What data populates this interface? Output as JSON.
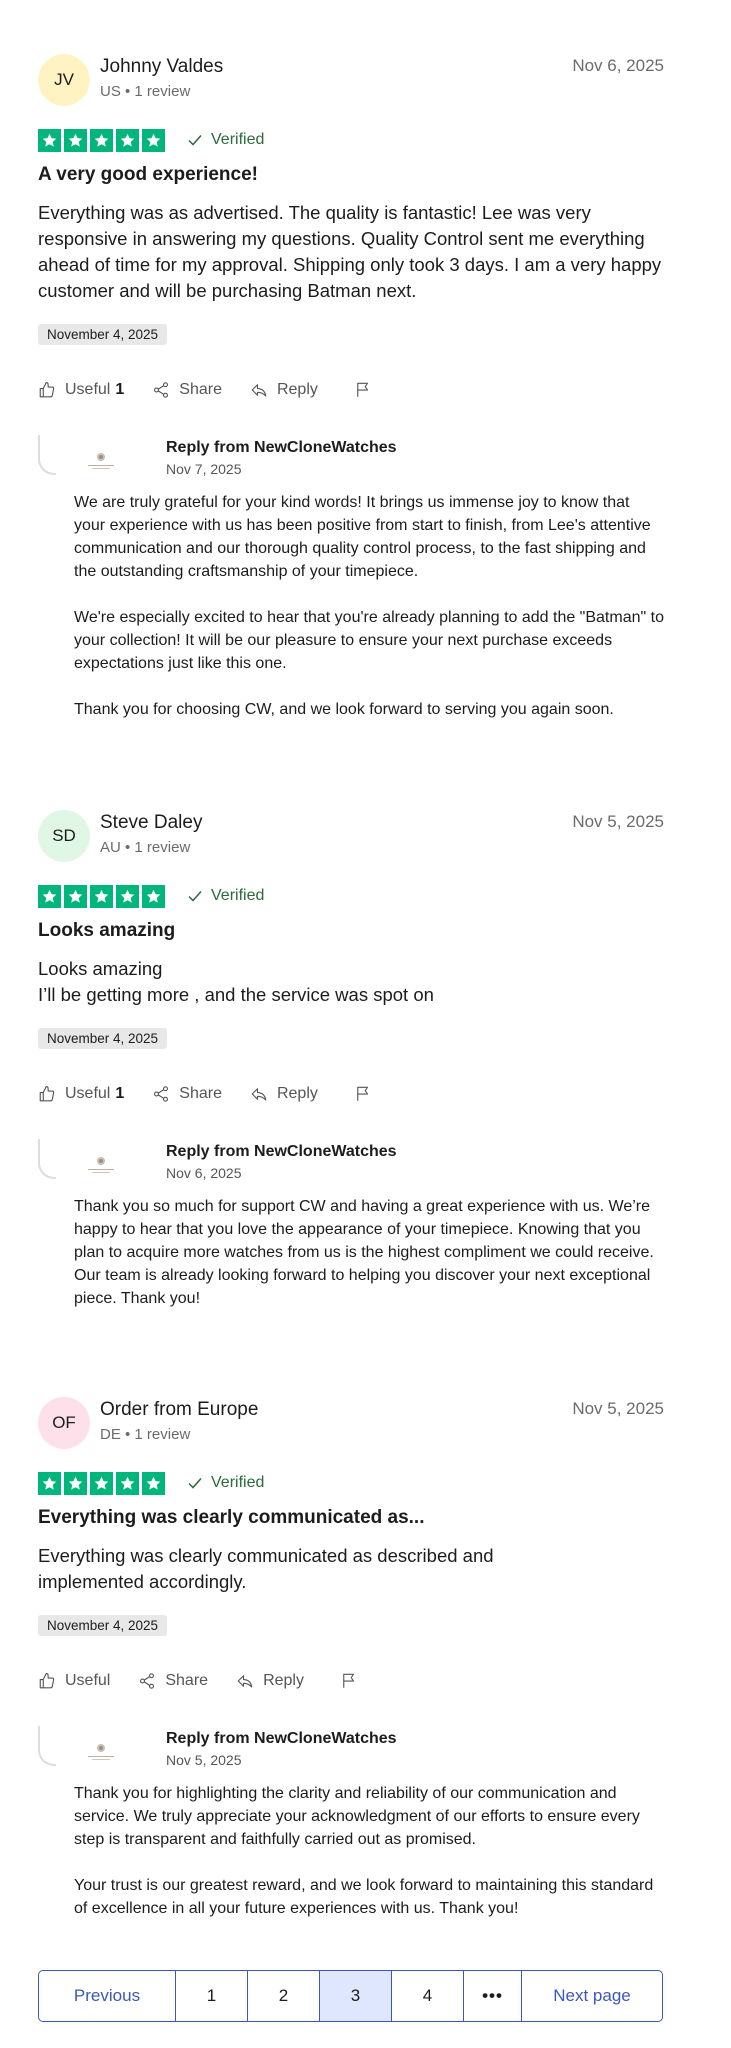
{
  "reviews": [
    {
      "initials": "JV",
      "author": "Johnny Valdes",
      "meta": "US • 1 review",
      "date": "Nov 6, 2025",
      "verified": "Verified",
      "title": "A very good experience!",
      "body": "Everything was as advertised. The quality is fantastic! Lee was very responsive in answering my questions. Quality Control sent me everything ahead of time for my approval. Shipping only took 3 days. I am a very happy customer and will be purchasing Batman next.",
      "experience_date": "November 4, 2025",
      "useful_label": "Useful",
      "useful_count": "1",
      "share_label": "Share",
      "reply_label": "Reply",
      "reply": {
        "from": "Reply from NewCloneWatches",
        "date": "Nov 7, 2025",
        "paragraphs": [
          "We are truly grateful for your kind words! It brings us immense joy to know that your experience with us has been positive from start to finish, from Lee's attentive communication and our thorough quality control process, to the fast shipping and the outstanding craftsmanship of your timepiece.",
          "We're especially excited to hear that you're already planning to add the \"Batman\" to your collection! It will be our pleasure to ensure your next purchase exceeds expectations just like this one.",
          "Thank you for choosing CW, and we look forward to serving you again soon."
        ]
      }
    },
    {
      "initials": "SD",
      "author": "Steve Daley",
      "meta": "AU • 1 review",
      "date": "Nov 5, 2025",
      "verified": "Verified",
      "title": "Looks amazing",
      "body_line1": "Looks amazing",
      "body_line2": "I’ll be getting more , and the service was spot on",
      "experience_date": "November 4, 2025",
      "useful_label": "Useful",
      "useful_count": "1",
      "share_label": "Share",
      "reply_label": "Reply",
      "reply": {
        "from": "Reply from NewCloneWatches",
        "date": "Nov 6, 2025",
        "paragraphs": [
          "Thank you so much for support CW and having a great experience with us. We’re happy to hear that you love the appearance of your timepiece. Knowing that you plan to acquire more watches from us is the highest compliment we could receive. Our team is already looking forward to helping you discover your next exceptional piece. Thank you!"
        ]
      }
    },
    {
      "initials": "OF",
      "author": "Order from Europe",
      "meta": "DE • 1 review",
      "date": "Nov 5, 2025",
      "verified": "Verified",
      "title": "Everything was clearly communicated as...",
      "body": "Everything was clearly communicated as described and implemented accordingly.",
      "experience_date": "November 4, 2025",
      "useful_label": "Useful",
      "share_label": "Share",
      "reply_label": "Reply",
      "reply": {
        "from": "Reply from NewCloneWatches",
        "date": "Nov 5, 2025",
        "paragraphs": [
          "Thank you for highlighting the clarity and reliability of our communication and service. We truly appreciate your acknowledgment of our efforts to ensure every step is transparent and faithfully carried out as promised.",
          "Your trust is our greatest reward, and we look forward to maintaining this standard of excellence in all your future experiences with us. Thank you!"
        ]
      }
    }
  ],
  "pagination": {
    "previous": "Previous",
    "pages": [
      "1",
      "2",
      "3",
      "4"
    ],
    "active": "3",
    "more": "•••",
    "next": "Next page"
  },
  "colors": {
    "star_green": "#00b67a",
    "link_blue": "#3c57bc",
    "active_page_bg": "#dfe7ff",
    "verified_green": "#2b6a3c"
  },
  "icons": [
    "star-icon",
    "check-icon",
    "thumbs-up-icon",
    "share-icon",
    "reply-icon",
    "flag-icon",
    "company-logo-icon"
  ]
}
